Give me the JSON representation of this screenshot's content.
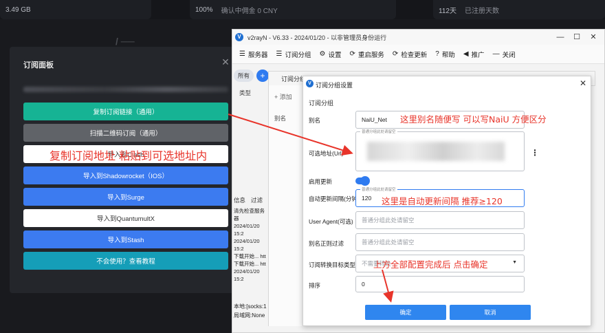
{
  "background": {
    "stats": [
      {
        "value": "3.49 GB",
        "label": ""
      },
      {
        "value": "100%",
        "label": "确认中佣金 0 CNY"
      },
      {
        "value": "112天",
        "label": "已注册天数"
      }
    ]
  },
  "panel": {
    "title": "订阅面板",
    "buttons": [
      {
        "label": "复制订阅链接（通用）"
      },
      {
        "label": "扫描二维码订阅（通用）"
      },
      {
        "label": "导入到Clash"
      },
      {
        "label": "导入到Shadowrocket（IOS）"
      },
      {
        "label": "导入到Surge"
      },
      {
        "label": "导入到QuantumultX"
      },
      {
        "label": "导入到Stash"
      },
      {
        "label": "不会使用？查看教程"
      }
    ]
  },
  "annotations": {
    "copy_hint": "复制订阅地址 粘贴到可选地址内",
    "alias_hint": "这里别名随便写 可以写NaiU 方便区分",
    "interval_hint": "这里是自动更新间隔 推荐≥120",
    "confirm_hint": "上方全部配置完成后 点击确定"
  },
  "app": {
    "title": "v2rayN - V6.33 - 2024/01/20 - 以非管理员身份运行",
    "toolbar": [
      {
        "icon": "servers-icon",
        "glyph": "☰",
        "label": "服务器"
      },
      {
        "icon": "subscription-icon",
        "glyph": "☰",
        "label": "订阅分组"
      },
      {
        "icon": "settings-icon",
        "glyph": "⚙",
        "label": "设置"
      },
      {
        "icon": "restart-icon",
        "glyph": "⟳",
        "label": "重启服务"
      },
      {
        "icon": "update-icon",
        "glyph": "⟳",
        "label": "检查更新"
      },
      {
        "icon": "help-icon",
        "glyph": "?",
        "label": "帮助"
      },
      {
        "icon": "promote-icon",
        "glyph": "◀",
        "label": "推广"
      },
      {
        "icon": "close-icon",
        "glyph": "—",
        "label": "关闭"
      }
    ],
    "tab_all": "所有",
    "column_type": "类型",
    "log_tabs": [
      "信息",
      "过滤"
    ],
    "log_lines": [
      "清先检查服务器",
      "2024/01/20 15:2",
      "2024/01/20 15:2",
      "下载开始...  htt",
      "下载开始...  htt",
      "2024/01/20 15:2"
    ],
    "status_lines": [
      "本地:[socks:1",
      "局域网:None"
    ]
  },
  "group_window": {
    "title": "订阅分组编辑",
    "add_label": "添加",
    "alias_col": "别名"
  },
  "dialog": {
    "title": "订阅分组设置",
    "section": "订阅分组",
    "fields": {
      "alias": {
        "label": "别名",
        "value": "NaiU_Net"
      },
      "url": {
        "label": "可选地址(Url)",
        "hint": "普通分组此处请留空"
      },
      "enable_update": {
        "label": "启用更新",
        "on": true
      },
      "interval": {
        "label": "自动更新间隔(分钟)",
        "hint": "普通分组此处请留空",
        "value": "120"
      },
      "user_agent": {
        "label": "User Agent(可选)",
        "placeholder": "普通分组此处请留空"
      },
      "filter": {
        "label": "别名正则过滤",
        "placeholder": "普通分组此处请留空"
      },
      "convert_target": {
        "label": "订阅转换目标类型",
        "placeholder": "不需要转换"
      },
      "sort": {
        "label": "排序",
        "value": "0"
      }
    },
    "ok_label": "确定",
    "cancel_label": "取消"
  },
  "colors": {
    "accent_blue": "#2f7bf0",
    "teal": "#16b394",
    "annotation_red": "#e8342a"
  }
}
